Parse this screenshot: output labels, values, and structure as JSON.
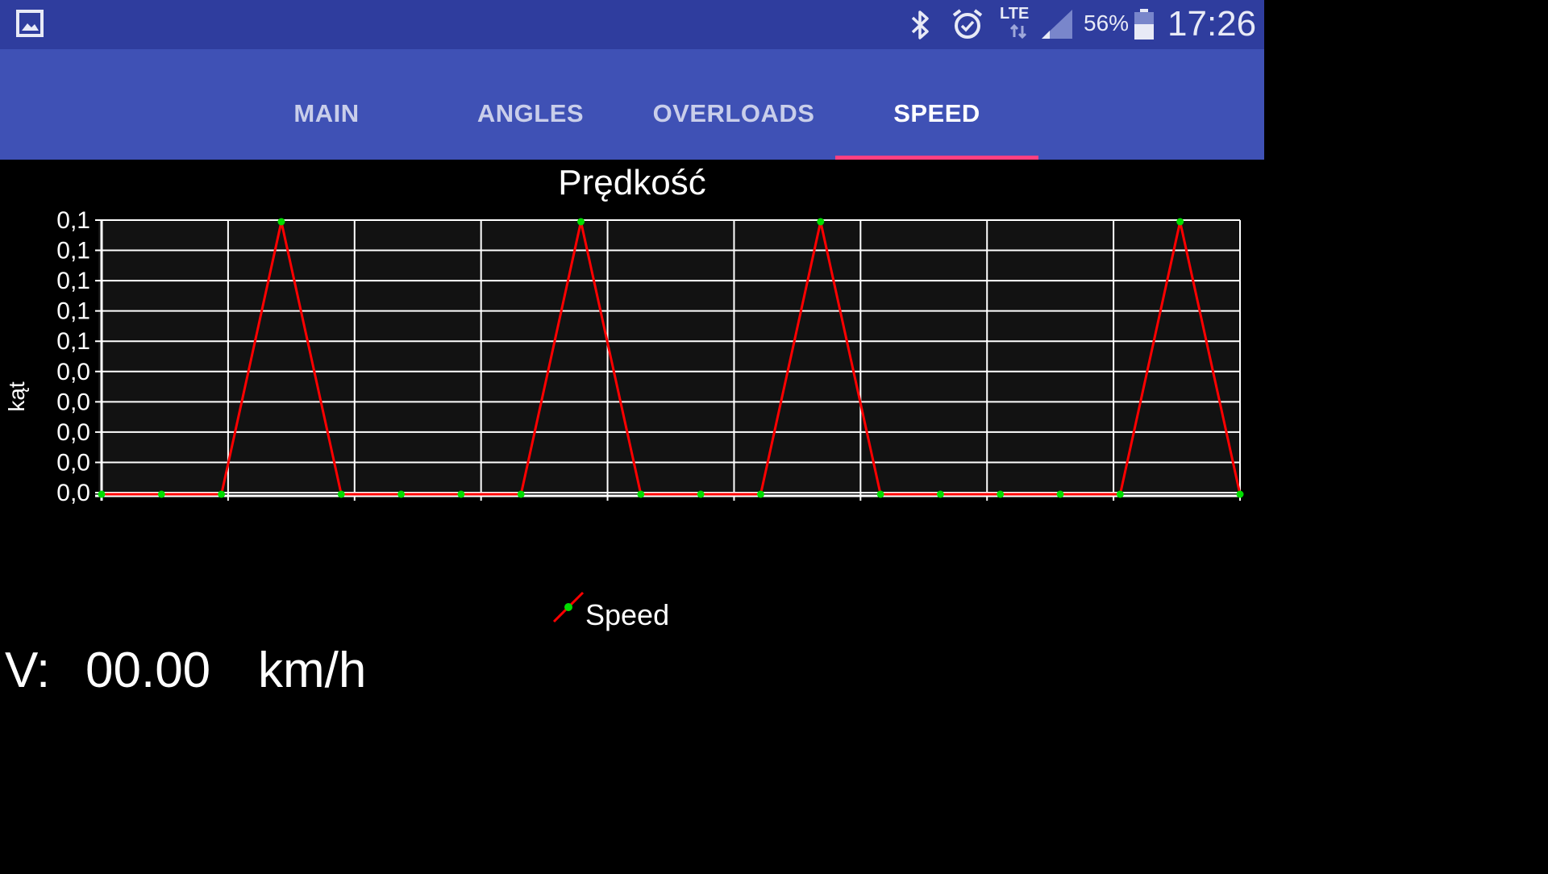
{
  "status_bar": {
    "network": "LTE",
    "battery": "56%",
    "time": "17:26",
    "icons": [
      "gallery-icon",
      "bluetooth-icon",
      "alarm-icon",
      "lte-arrows-icon",
      "signal-icon",
      "battery-icon"
    ]
  },
  "tabs": [
    {
      "label": "MAIN",
      "active": false
    },
    {
      "label": "ANGLES",
      "active": false
    },
    {
      "label": "OVERLOADS",
      "active": false
    },
    {
      "label": "SPEED",
      "active": true
    }
  ],
  "colors": {
    "status_bar": "#2f3d9e",
    "tab_bar": "#3f51b5",
    "tab_indicator": "#ff4081",
    "series_line": "#ff0000",
    "series_points": "#00dd00",
    "plot_background": "#121212",
    "grid": "#ffffff"
  },
  "chart_data": {
    "type": "line",
    "title": "Prędkość",
    "xlabel": "",
    "ylabel": "kąt",
    "ytick_labels": [
      "0,1",
      "0,1",
      "0,1",
      "0,1",
      "0,1",
      "0,0",
      "0,0",
      "0,0",
      "0,0",
      "0,0"
    ],
    "ylim": [
      0,
      0.1
    ],
    "grid": true,
    "legend_position": "bottom-center",
    "series": [
      {
        "name": "Speed",
        "x": [
          0,
          1,
          2,
          3,
          4,
          5,
          6,
          7,
          8,
          9,
          10,
          11,
          12,
          13,
          14,
          15,
          16,
          17,
          18,
          19
        ],
        "values": [
          0,
          0,
          0,
          0.1,
          0,
          0,
          0,
          0,
          0.1,
          0,
          0,
          0,
          0.1,
          0,
          0,
          0,
          0,
          0,
          0.1,
          0
        ]
      }
    ]
  },
  "speed_readout": {
    "prefix": "V:",
    "value": "00.00",
    "unit": "km/h"
  }
}
